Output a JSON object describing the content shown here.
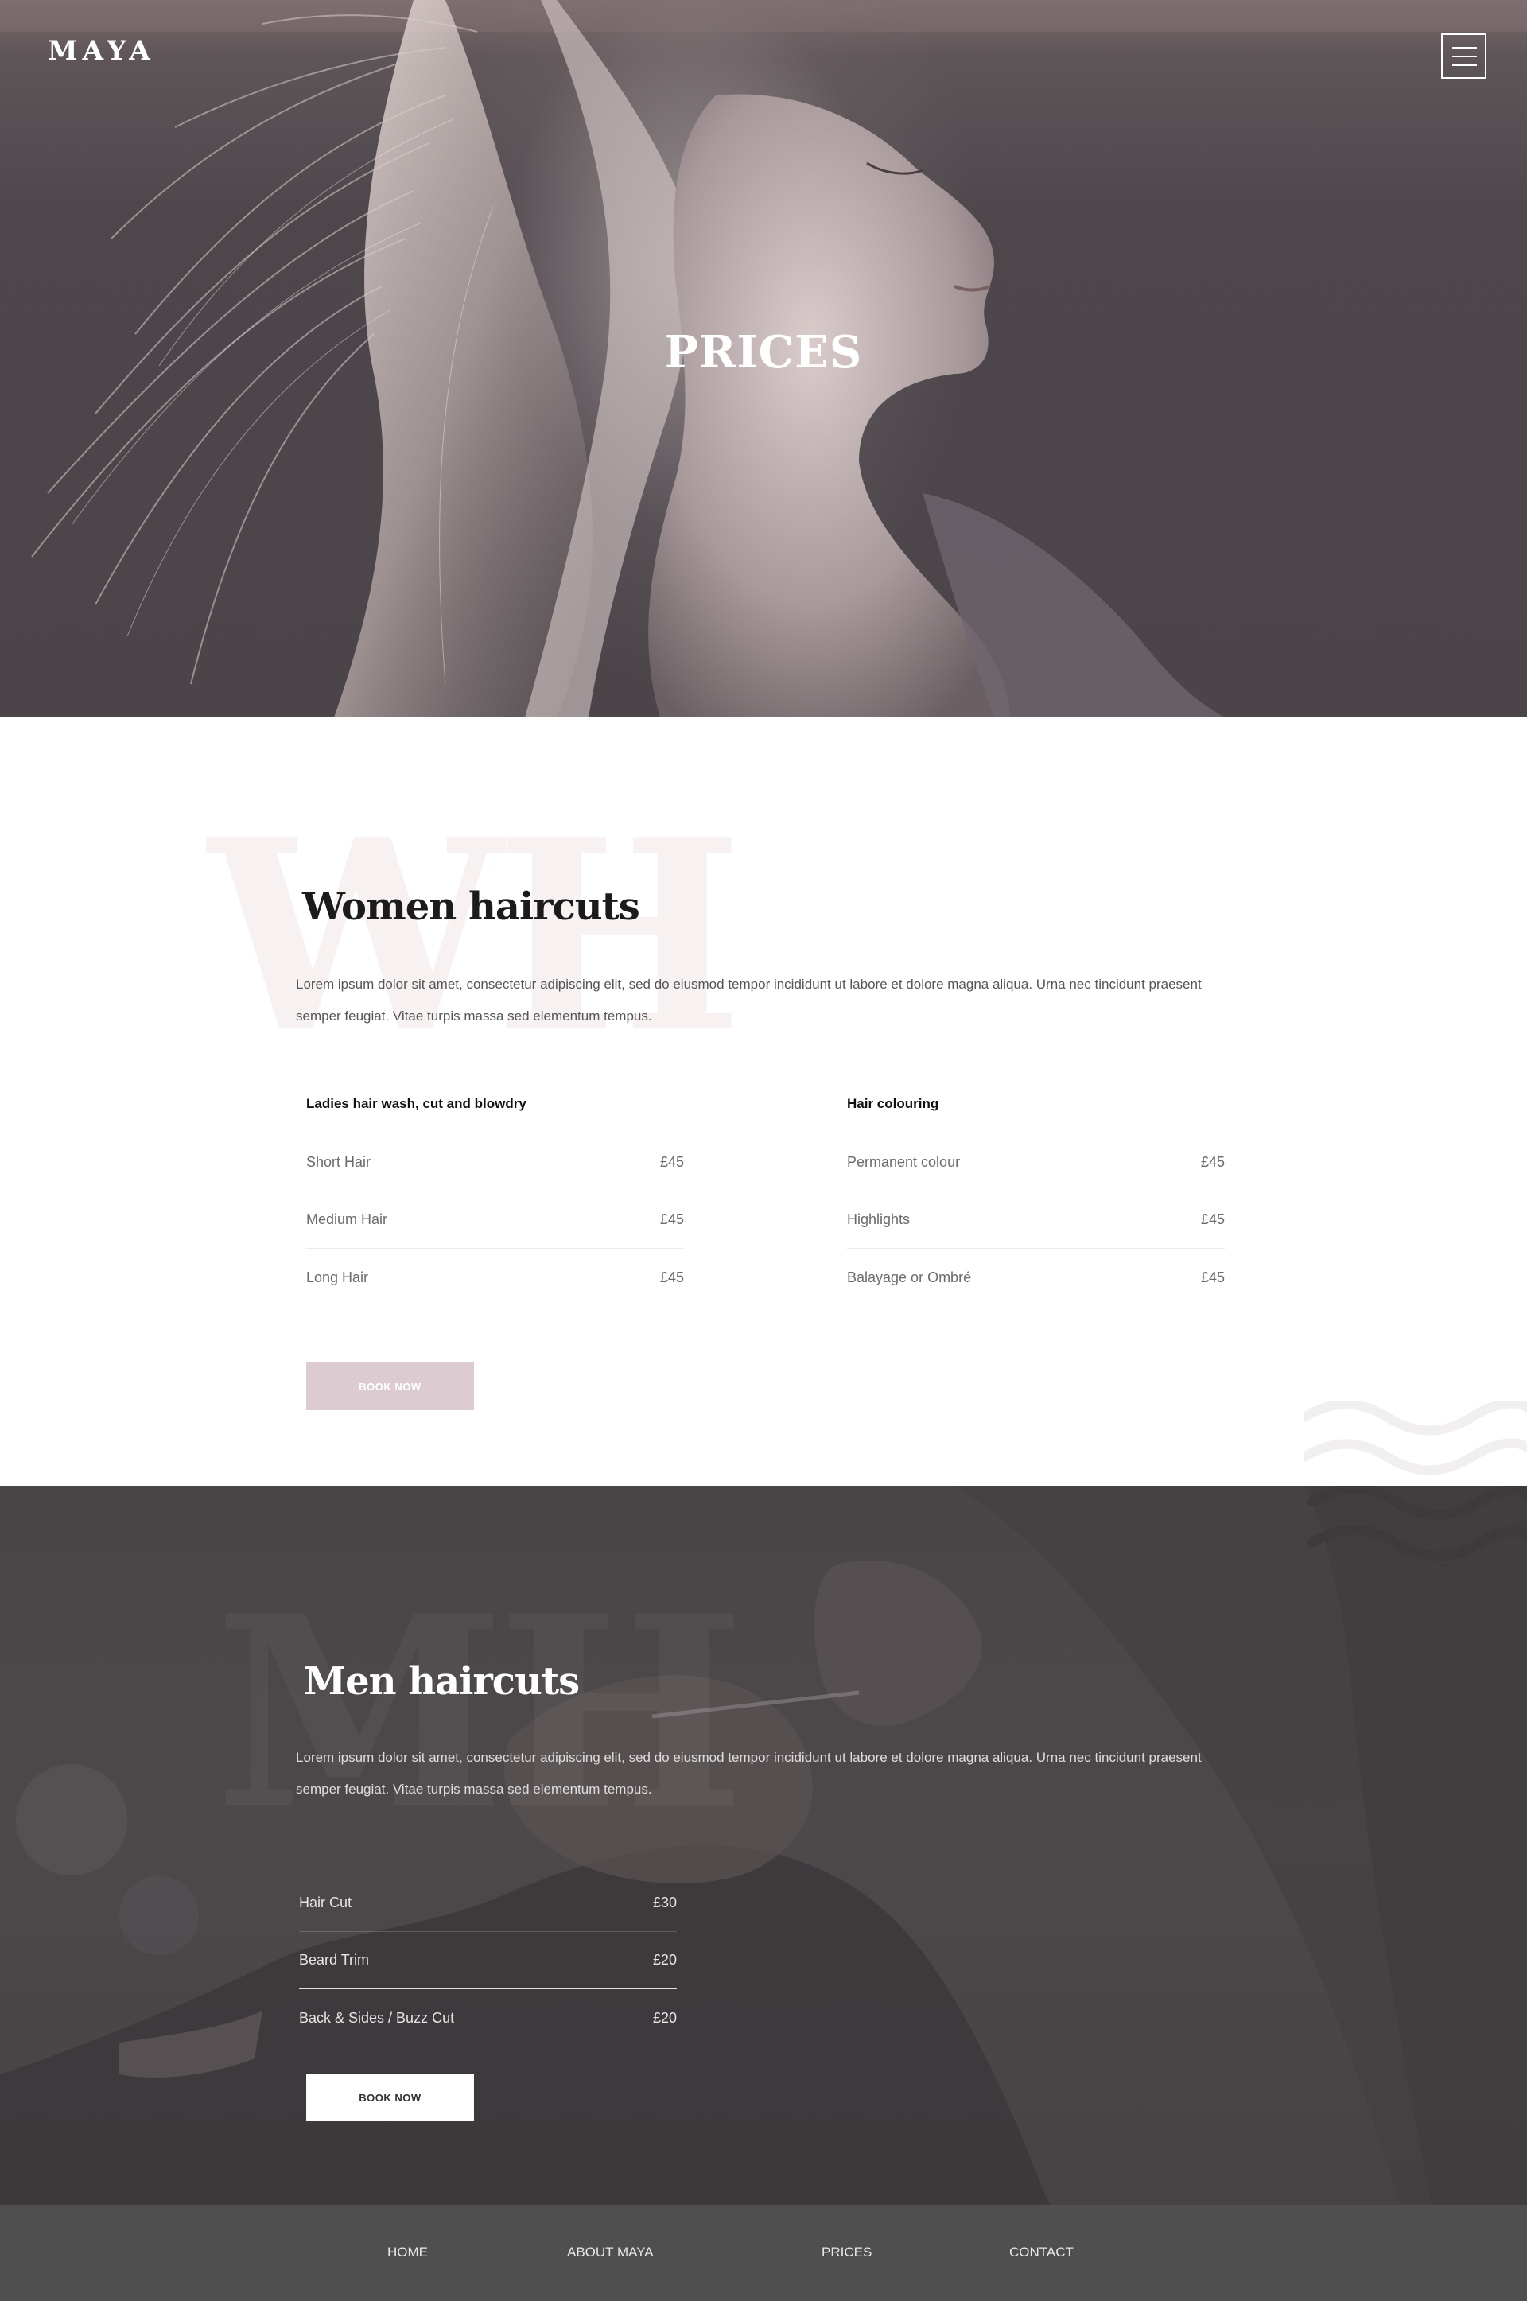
{
  "brand": {
    "logo": "MAYA"
  },
  "header": {
    "menu_icon": "hamburger-icon"
  },
  "hero": {
    "title": "PRICES"
  },
  "women": {
    "ghost_text": "WH",
    "title": "Women haircuts",
    "description": "Lorem ipsum dolor sit amet, consectetur adipiscing elit, sed do eiusmod tempor incididunt ut labore et dolore magna aliqua. Urna nec tincidunt praesent semper feugiat. Vitae turpis massa sed elementum tempus.",
    "columns": [
      {
        "heading": "Ladies hair wash, cut and blowdry",
        "items": [
          {
            "name": "Short Hair",
            "price": "£45"
          },
          {
            "name": "Medium Hair",
            "price": "£45"
          },
          {
            "name": "Long Hair",
            "price": "£45"
          }
        ]
      },
      {
        "heading": "Hair colouring",
        "items": [
          {
            "name": "Permanent colour",
            "price": "£45"
          },
          {
            "name": "Highlights",
            "price": "£45"
          },
          {
            "name": "Balayage or Ombré",
            "price": "£45"
          }
        ]
      }
    ],
    "book_label": "BOOK NOW",
    "accent_color": "#dccbd0"
  },
  "men": {
    "ghost_text": "MH",
    "title": "Men haircuts",
    "description": "Lorem ipsum dolor sit amet, consectetur adipiscing elit, sed do eiusmod tempor incididunt ut labore et dolore magna aliqua. Urna nec tincidunt praesent semper feugiat. Vitae turpis massa sed elementum tempus.",
    "items": [
      {
        "name": "Hair Cut",
        "price": "£30"
      },
      {
        "name": "Beard Trim",
        "price": "£20"
      },
      {
        "name": "Back & Sides / Buzz Cut",
        "price": "£20"
      }
    ],
    "book_label": "BOOK NOW"
  },
  "footer": {
    "links": [
      "HOME",
      "ABOUT MAYA",
      "PRICES",
      "CONTACT"
    ]
  }
}
